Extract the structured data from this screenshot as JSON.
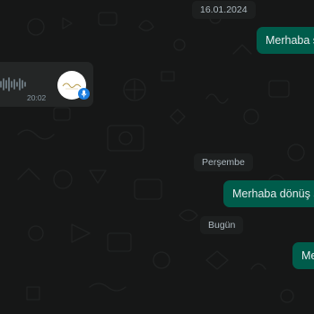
{
  "date_chips": {
    "first": "16.01.2024",
    "second": "Perşembe",
    "third": "Bugün"
  },
  "messages": {
    "outgoing_1": "Merhaba sa",
    "outgoing_2": "Merhaba dönüş sa",
    "outgoing_3": "Me"
  },
  "voice_message": {
    "duration": "20:02",
    "avatar_icon": "profile-avatar-logo",
    "mic_icon": "microphone-icon"
  },
  "colors": {
    "background": "#161717",
    "outgoing_bubble": "#005c4b",
    "incoming_bubble": "#242626",
    "date_chip": "#1d1f1f",
    "mic_badge": "#1b7ee0"
  }
}
